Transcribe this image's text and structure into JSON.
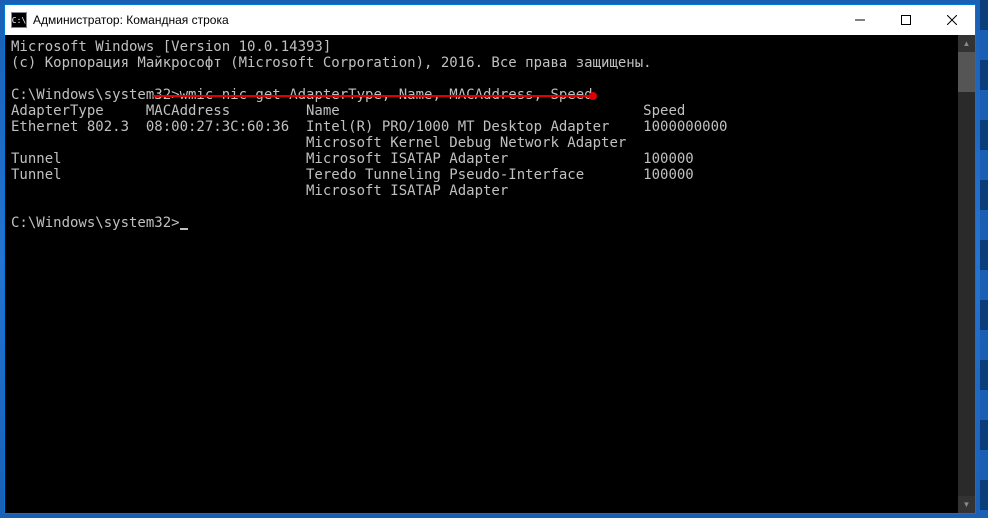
{
  "window": {
    "title": "Администратор: Командная строка"
  },
  "console": {
    "header_line1": "Microsoft Windows [Version 10.0.14393]",
    "header_line2": "(c) Корпорация Майкрософт (Microsoft Corporation), 2016. Все права защищены.",
    "prompt1": "C:\\Windows\\system32>",
    "command": "wmic nic get AdapterType, Name, MACAddress, Speed",
    "columns": {
      "col1": "AdapterType",
      "col2": "MACAddress",
      "col3": "Name",
      "col4": "Speed"
    },
    "rows": [
      {
        "adapter_type": "Ethernet 802.3",
        "mac": "08:00:27:3C:60:36",
        "name": "Intel(R) PRO/1000 MT Desktop Adapter",
        "speed": "1000000000"
      },
      {
        "adapter_type": "",
        "mac": "",
        "name": "Microsoft Kernel Debug Network Adapter",
        "speed": ""
      },
      {
        "adapter_type": "Tunnel",
        "mac": "",
        "name": "Microsoft ISATAP Adapter",
        "speed": "100000"
      },
      {
        "adapter_type": "Tunnel",
        "mac": "",
        "name": "Teredo Tunneling Pseudo-Interface",
        "speed": "100000"
      },
      {
        "adapter_type": "",
        "mac": "",
        "name": "Microsoft ISATAP Adapter",
        "speed": ""
      }
    ],
    "prompt2": "C:\\Windows\\system32>"
  }
}
